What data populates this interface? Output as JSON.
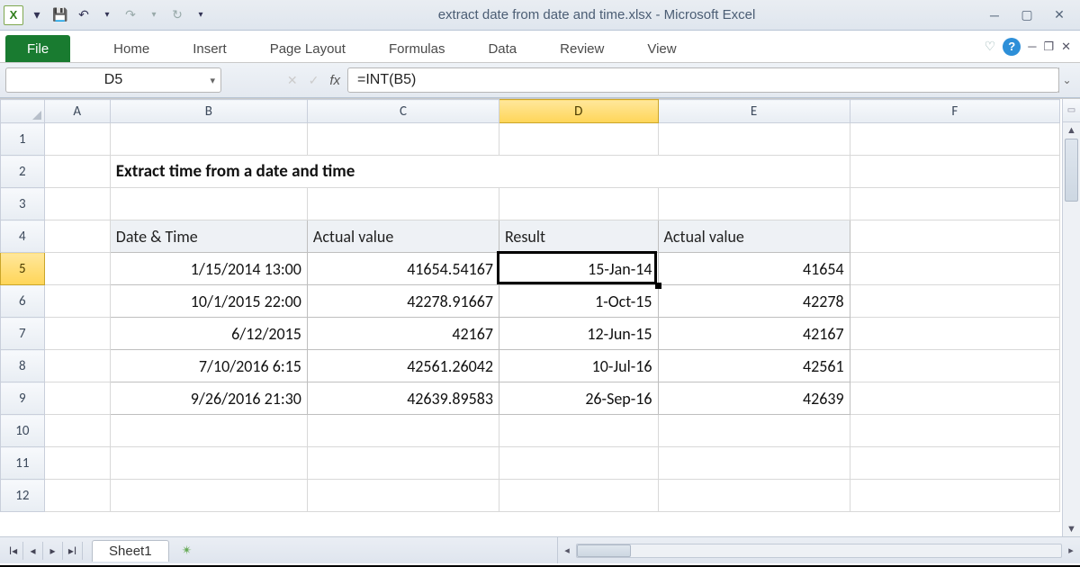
{
  "titlebar": {
    "title": "extract date from date and time.xlsx  -  Microsoft Excel"
  },
  "ribbon": {
    "file": "File",
    "tabs": [
      "Home",
      "Insert",
      "Page Layout",
      "Formulas",
      "Data",
      "Review",
      "View"
    ]
  },
  "formula_bar": {
    "name_box": "D5",
    "fx": "fx",
    "formula": "=INT(B5)"
  },
  "columns": [
    "A",
    "B",
    "C",
    "D",
    "E",
    "F"
  ],
  "selected_column": "D",
  "row_numbers": [
    1,
    2,
    3,
    4,
    5,
    6,
    7,
    8,
    9,
    10,
    11,
    12
  ],
  "selected_row": 5,
  "sheet_tabs": {
    "active": "Sheet1"
  },
  "heading": "Extract time from a date and time",
  "table": {
    "headers": [
      "Date & Time",
      "Actual value",
      "Result",
      "Actual value"
    ],
    "rows": [
      {
        "B": "1/15/2014 13:00",
        "C": "41654.54167",
        "D": "15-Jan-14",
        "E": "41654"
      },
      {
        "B": "10/1/2015 22:00",
        "C": "42278.91667",
        "D": "1-Oct-15",
        "E": "42278"
      },
      {
        "B": "6/12/2015",
        "C": "42167",
        "D": "12-Jun-15",
        "E": "42167"
      },
      {
        "B": "7/10/2016 6:15",
        "C": "42561.26042",
        "D": "10-Jul-16",
        "E": "42561"
      },
      {
        "B": "9/26/2016 21:30",
        "C": "42639.89583",
        "D": "26-Sep-16",
        "E": "42639"
      }
    ]
  },
  "chart_data": {
    "type": "table",
    "title": "Extract time from a date and time",
    "columns": [
      "Date & Time",
      "Actual value",
      "Result",
      "Actual value"
    ],
    "rows": [
      [
        "1/15/2014 13:00",
        41654.54167,
        "15-Jan-14",
        41654
      ],
      [
        "10/1/2015 22:00",
        42278.91667,
        "1-Oct-15",
        42278
      ],
      [
        "6/12/2015",
        42167,
        "12-Jun-15",
        42167
      ],
      [
        "7/10/2016 6:15",
        42561.26042,
        "10-Jul-16",
        42561
      ],
      [
        "9/26/2016 21:30",
        42639.89583,
        "26-Sep-16",
        42639
      ]
    ]
  }
}
